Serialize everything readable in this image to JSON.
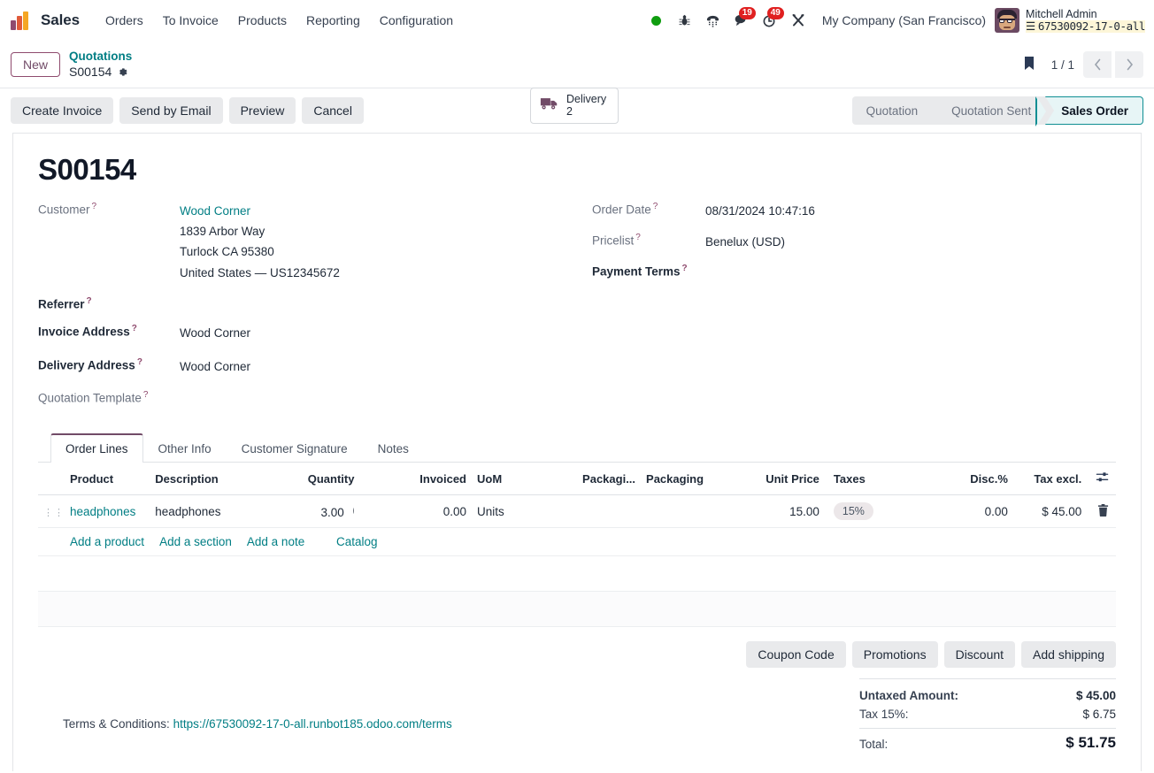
{
  "navbar": {
    "app_name": "Sales",
    "menu": [
      {
        "label": "Orders"
      },
      {
        "label": "To Invoice"
      },
      {
        "label": "Products"
      },
      {
        "label": "Reporting"
      },
      {
        "label": "Configuration"
      }
    ],
    "icons": [
      {
        "name": "presence-online-dot",
        "glyph": ""
      },
      {
        "name": "bug-icon",
        "glyph": "⚙"
      },
      {
        "name": "voip-phone-icon",
        "glyph": "☎"
      },
      {
        "name": "messages-icon",
        "glyph": "✉",
        "badge": "19"
      },
      {
        "name": "activities-clock-icon",
        "glyph": "⏰",
        "badge": "49"
      },
      {
        "name": "tools-wrench-icon",
        "glyph": "⚒"
      }
    ],
    "message_badge": "19",
    "activity_badge": "49",
    "company": "My Company (San Francisco)",
    "user_name": "Mitchell Admin",
    "database": "67530092-17-0-all"
  },
  "control_panel": {
    "new_button": "New",
    "breadcrumb_parent": "Quotations",
    "breadcrumb_current": "S00154",
    "smart_button": {
      "label": "Delivery",
      "value": "2"
    },
    "pager": "1 / 1"
  },
  "actions": {
    "buttons": [
      {
        "label": "Create Invoice"
      },
      {
        "label": "Send by Email"
      },
      {
        "label": "Preview"
      },
      {
        "label": "Cancel"
      }
    ],
    "stages": [
      {
        "label": "Quotation",
        "active": false
      },
      {
        "label": "Quotation Sent",
        "active": false
      },
      {
        "label": "Sales Order",
        "active": true
      }
    ]
  },
  "record": {
    "title": "S00154",
    "left_fields": [
      {
        "label": "Customer",
        "optional": true,
        "link": "Wood Corner",
        "lines": [
          "1839 Arbor Way",
          "Turlock CA 95380",
          "United States — US12345672"
        ]
      },
      {
        "label": "Referrer",
        "optional": false,
        "value": ""
      },
      {
        "label": "Invoice Address",
        "optional": false,
        "value": "Wood Corner"
      },
      {
        "label": "Delivery Address",
        "optional": false,
        "value": "Wood Corner"
      },
      {
        "label": "Quotation Template",
        "optional": true,
        "value": ""
      }
    ],
    "right_fields": [
      {
        "label": "Order Date",
        "optional": true,
        "value": "08/31/2024 10:47:16"
      },
      {
        "label": "Pricelist",
        "optional": true,
        "value": "Benelux (USD)"
      },
      {
        "label": "Payment Terms",
        "optional": false,
        "value": ""
      }
    ]
  },
  "notebook": {
    "tabs": [
      {
        "label": "Order Lines",
        "active": true
      },
      {
        "label": "Other Info",
        "active": false
      },
      {
        "label": "Customer Signature",
        "active": false
      },
      {
        "label": "Notes",
        "active": false
      }
    ]
  },
  "lines_table": {
    "headers": [
      "Product",
      "Description",
      "Quantity",
      "Invoiced",
      "UoM",
      "Packagi...",
      "Packaging",
      "Unit Price",
      "Taxes",
      "Disc.%",
      "Tax excl."
    ],
    "rows": [
      {
        "product": "headphones",
        "description": "headphones",
        "quantity": "3.00",
        "quantity_overflow": "(",
        "invoiced": "0.00",
        "uom": "Units",
        "packaging_qty": "",
        "packaging": "",
        "unit_price": "15.00",
        "taxes": "15%",
        "discount": "0.00",
        "tax_excl": "$ 45.00"
      }
    ],
    "add_links": [
      {
        "label": "Add a product"
      },
      {
        "label": "Add a section"
      },
      {
        "label": "Add a note"
      },
      {
        "label": "Catalog"
      }
    ]
  },
  "footer": {
    "buttons": [
      {
        "label": "Coupon Code"
      },
      {
        "label": "Promotions"
      },
      {
        "label": "Discount"
      },
      {
        "label": "Add shipping"
      }
    ],
    "totals": [
      {
        "label": "Untaxed Amount:",
        "value": "$ 45.00",
        "bold": true
      },
      {
        "label": "Tax 15%:",
        "value": "$ 6.75",
        "bold": false
      }
    ],
    "grand_total": {
      "label": "Total:",
      "value": "$ 51.75"
    },
    "terms_label": "Terms & Conditions:",
    "terms_url": "https://67530092-17-0-all.runbot185.odoo.com/terms"
  },
  "colors": {
    "brand_purple": "#714b67",
    "link_teal": "#017e84",
    "stage_active_border": "#0f8e93",
    "stage_active_bg": "#e7f5f6",
    "badge_red": "#e02020",
    "online_green": "#0f9d0f"
  }
}
